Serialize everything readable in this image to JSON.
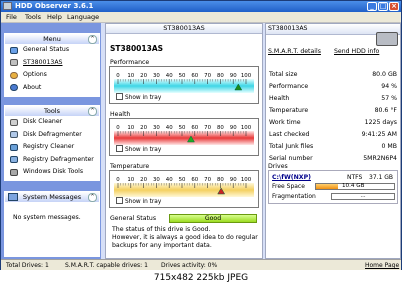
{
  "app": {
    "title": "HDD Observer 3.6.1"
  },
  "menu": [
    "File",
    "Tools",
    "Help",
    "Language"
  ],
  "sidebar": {
    "menu_header": "Menu",
    "menu_items": [
      "General Status",
      "ST380013AS",
      "Options",
      "About"
    ],
    "tools_header": "Tools",
    "tools_items": [
      "Disk Cleaner",
      "Disk Defragmenter",
      "Registry Cleaner",
      "Registry Defragmenter",
      "Windows Disk Tools"
    ],
    "messages_header": "System Messages",
    "messages_text": "No system messages."
  },
  "main": {
    "drive_title": "ST380013AS",
    "smart_link": "S.M.A.R.T. details",
    "send_link": "Send HDD info",
    "scale": [
      "0",
      "10",
      "20",
      "30",
      "40",
      "50",
      "60",
      "70",
      "80",
      "90",
      "100"
    ],
    "temp_scale": [
      "0",
      "10",
      "20",
      "30",
      "40",
      "50",
      "60",
      "70",
      "80",
      "90",
      "100"
    ],
    "performance": {
      "label": "Performance",
      "value": 94,
      "tray": "Show in tray"
    },
    "health": {
      "label": "Health",
      "value": 57,
      "tray": "Show in tray"
    },
    "temperature": {
      "label": "Temperature",
      "value": 80.6,
      "tray": "Show in tray"
    },
    "general_status": {
      "label": "General Status",
      "value": "Good",
      "message": "The status of this drive is Good.\nHowever, it is always a good idea to do regular backups for any important data."
    }
  },
  "info": [
    {
      "k": "Total size",
      "v": "80.0 GB"
    },
    {
      "k": "Performance",
      "v": "94 %"
    },
    {
      "k": "Health",
      "v": "57 %"
    },
    {
      "k": "Temperature",
      "v": "80.6 °F"
    },
    {
      "k": "Work time",
      "v": "1225 days"
    },
    {
      "k": "Last checked",
      "v": "9:41:25 AM"
    },
    {
      "k": "Total Junk files",
      "v": "0 MB"
    },
    {
      "k": "Serial number",
      "v": "5MR2N6P4"
    }
  ],
  "drives": {
    "header": "Drives",
    "name": "C:\\fW(NXP)",
    "fs": "NTFS",
    "size": "37.1 GB",
    "free_label": "Free Space",
    "free_value": "10.4 GB",
    "free_fraction": 0.28,
    "frag_label": "Fragmentation",
    "frag_value": "..."
  },
  "status": {
    "total": "Total Drives: 1",
    "smart": "S.M.A.R.T. capable drives: 1",
    "activity": "Drives activity: 0%",
    "home": "Home Page"
  },
  "caption": "715x482  225kb  JPEG",
  "colors": {
    "good": "#b8f040",
    "perf_marker": "#1a8a1a",
    "title_bar": "#2060c8"
  }
}
